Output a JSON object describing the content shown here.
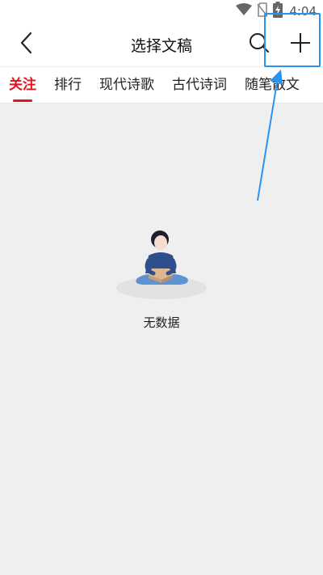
{
  "status_bar": {
    "time": "4:04",
    "icons": [
      "wifi-icon",
      "no-sim-icon",
      "battery-charging-icon"
    ]
  },
  "header": {
    "title": "选择文稿",
    "back_icon": "chevron-left-icon",
    "search_icon": "search-icon",
    "add_icon": "plus-icon"
  },
  "tabs": [
    {
      "label": "关注",
      "active": true
    },
    {
      "label": "排行",
      "active": false
    },
    {
      "label": "现代诗歌",
      "active": false
    },
    {
      "label": "古代诗词",
      "active": false
    },
    {
      "label": "随笔散文",
      "active": false
    }
  ],
  "empty_state": {
    "text": "无数据",
    "illustration_icon": "person-with-box-illustration"
  },
  "colors": {
    "accent": "#e0131f",
    "background": "#efeff0",
    "annotation": "#2a93f0"
  }
}
